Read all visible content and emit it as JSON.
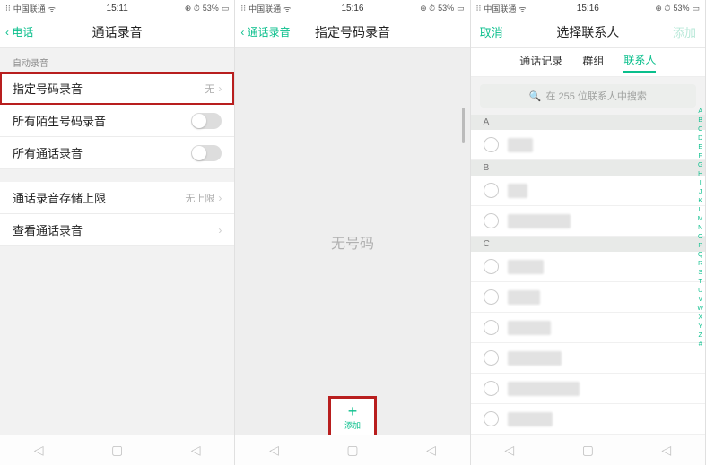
{
  "status": {
    "carrier": "中国联通",
    "battery": "53%",
    "alarm_icon": "⏰"
  },
  "screen1": {
    "time": "15:11",
    "back_label": "电话",
    "title": "通话录音",
    "section_label": "自动录音",
    "row_designated": "指定号码录音",
    "row_designated_value": "无",
    "row_stranger": "所有陌生号码录音",
    "row_all": "所有通话录音",
    "row_storage": "通话录音存储上限",
    "row_storage_value": "无上限",
    "row_view": "查看通话录音"
  },
  "screen2": {
    "time": "15:16",
    "back_label": "通话录音",
    "title": "指定号码录音",
    "empty_text": "无号码",
    "add_label": "添加"
  },
  "screen3": {
    "time": "15:16",
    "cancel": "取消",
    "title": "选择联系人",
    "add": "添加",
    "tabs": {
      "history": "通话记录",
      "groups": "群组",
      "contacts": "联系人"
    },
    "search_placeholder": "在 255 位联系人中搜索",
    "index_letters": [
      "A",
      "B",
      "C",
      "D",
      "E",
      "F",
      "G",
      "H",
      "I",
      "J",
      "K",
      "L",
      "M",
      "N",
      "O",
      "P",
      "Q",
      "R",
      "S",
      "T",
      "U",
      "V",
      "W",
      "X",
      "Y",
      "Z",
      "#"
    ],
    "sections": [
      {
        "letter": "A",
        "rows": [
          1
        ]
      },
      {
        "letter": "B",
        "rows": [
          1,
          1
        ]
      },
      {
        "letter": "C",
        "rows": [
          1,
          1,
          1,
          1,
          1,
          1
        ]
      }
    ]
  }
}
